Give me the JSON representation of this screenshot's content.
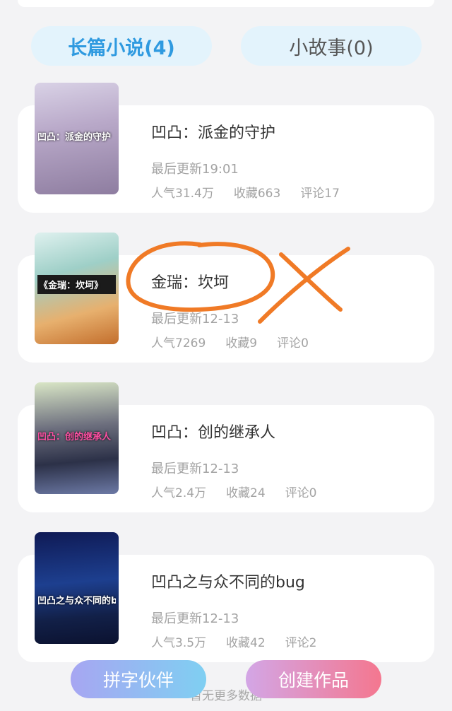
{
  "tabs": {
    "novels": "长篇小说(4)",
    "stories": "小故事(0)"
  },
  "books": [
    {
      "title": "凹凸：派金的守护",
      "cover_text": "凹凸：派金的守护",
      "updated": "最后更新19:01",
      "popularity": "人气31.4万",
      "favorites": "收藏663",
      "comments": "评论17"
    },
    {
      "title": "金瑞：坎坷",
      "cover_text": "《金瑞：坎坷》",
      "updated": "最后更新12-13",
      "popularity": "人气7269",
      "favorites": "收藏9",
      "comments": "评论0"
    },
    {
      "title": "凹凸：创的继承人",
      "cover_text": "凹凸：创的继承人",
      "updated": "最后更新12-13",
      "popularity": "人气2.4万",
      "favorites": "收藏24",
      "comments": "评论0"
    },
    {
      "title": "凹凸之与众不同的bug",
      "cover_text": "凹凸之与众不同的bug",
      "updated": "最后更新12-13",
      "popularity": "人气3.5万",
      "favorites": "收藏42",
      "comments": "评论2"
    }
  ],
  "actions": {
    "partner": "拼字伙伴",
    "create": "创建作品"
  },
  "footer": "暂无更多数据",
  "colors": {
    "accent": "#2f9ae0",
    "annotation": "#f07a26"
  }
}
